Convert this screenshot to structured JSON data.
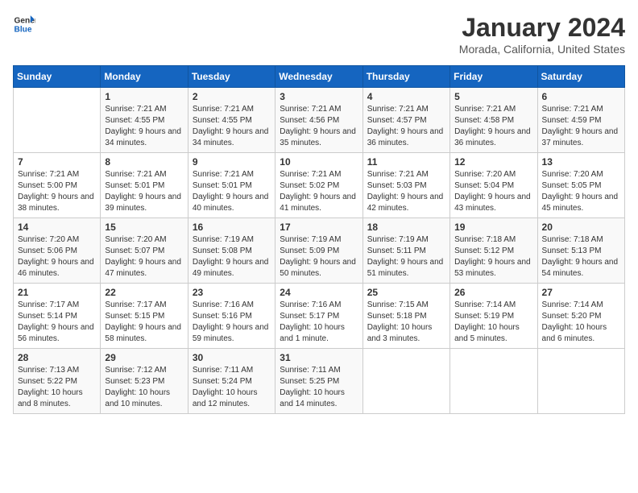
{
  "logo": {
    "line1": "General",
    "line2": "Blue"
  },
  "title": "January 2024",
  "subtitle": "Morada, California, United States",
  "weekdays": [
    "Sunday",
    "Monday",
    "Tuesday",
    "Wednesday",
    "Thursday",
    "Friday",
    "Saturday"
  ],
  "weeks": [
    [
      {
        "day": "",
        "sunrise": "",
        "sunset": "",
        "daylight": ""
      },
      {
        "day": "1",
        "sunrise": "Sunrise: 7:21 AM",
        "sunset": "Sunset: 4:55 PM",
        "daylight": "Daylight: 9 hours and 34 minutes."
      },
      {
        "day": "2",
        "sunrise": "Sunrise: 7:21 AM",
        "sunset": "Sunset: 4:55 PM",
        "daylight": "Daylight: 9 hours and 34 minutes."
      },
      {
        "day": "3",
        "sunrise": "Sunrise: 7:21 AM",
        "sunset": "Sunset: 4:56 PM",
        "daylight": "Daylight: 9 hours and 35 minutes."
      },
      {
        "day": "4",
        "sunrise": "Sunrise: 7:21 AM",
        "sunset": "Sunset: 4:57 PM",
        "daylight": "Daylight: 9 hours and 36 minutes."
      },
      {
        "day": "5",
        "sunrise": "Sunrise: 7:21 AM",
        "sunset": "Sunset: 4:58 PM",
        "daylight": "Daylight: 9 hours and 36 minutes."
      },
      {
        "day": "6",
        "sunrise": "Sunrise: 7:21 AM",
        "sunset": "Sunset: 4:59 PM",
        "daylight": "Daylight: 9 hours and 37 minutes."
      }
    ],
    [
      {
        "day": "7",
        "sunrise": "Sunrise: 7:21 AM",
        "sunset": "Sunset: 5:00 PM",
        "daylight": "Daylight: 9 hours and 38 minutes."
      },
      {
        "day": "8",
        "sunrise": "Sunrise: 7:21 AM",
        "sunset": "Sunset: 5:01 PM",
        "daylight": "Daylight: 9 hours and 39 minutes."
      },
      {
        "day": "9",
        "sunrise": "Sunrise: 7:21 AM",
        "sunset": "Sunset: 5:01 PM",
        "daylight": "Daylight: 9 hours and 40 minutes."
      },
      {
        "day": "10",
        "sunrise": "Sunrise: 7:21 AM",
        "sunset": "Sunset: 5:02 PM",
        "daylight": "Daylight: 9 hours and 41 minutes."
      },
      {
        "day": "11",
        "sunrise": "Sunrise: 7:21 AM",
        "sunset": "Sunset: 5:03 PM",
        "daylight": "Daylight: 9 hours and 42 minutes."
      },
      {
        "day": "12",
        "sunrise": "Sunrise: 7:20 AM",
        "sunset": "Sunset: 5:04 PM",
        "daylight": "Daylight: 9 hours and 43 minutes."
      },
      {
        "day": "13",
        "sunrise": "Sunrise: 7:20 AM",
        "sunset": "Sunset: 5:05 PM",
        "daylight": "Daylight: 9 hours and 45 minutes."
      }
    ],
    [
      {
        "day": "14",
        "sunrise": "Sunrise: 7:20 AM",
        "sunset": "Sunset: 5:06 PM",
        "daylight": "Daylight: 9 hours and 46 minutes."
      },
      {
        "day": "15",
        "sunrise": "Sunrise: 7:20 AM",
        "sunset": "Sunset: 5:07 PM",
        "daylight": "Daylight: 9 hours and 47 minutes."
      },
      {
        "day": "16",
        "sunrise": "Sunrise: 7:19 AM",
        "sunset": "Sunset: 5:08 PM",
        "daylight": "Daylight: 9 hours and 49 minutes."
      },
      {
        "day": "17",
        "sunrise": "Sunrise: 7:19 AM",
        "sunset": "Sunset: 5:09 PM",
        "daylight": "Daylight: 9 hours and 50 minutes."
      },
      {
        "day": "18",
        "sunrise": "Sunrise: 7:19 AM",
        "sunset": "Sunset: 5:11 PM",
        "daylight": "Daylight: 9 hours and 51 minutes."
      },
      {
        "day": "19",
        "sunrise": "Sunrise: 7:18 AM",
        "sunset": "Sunset: 5:12 PM",
        "daylight": "Daylight: 9 hours and 53 minutes."
      },
      {
        "day": "20",
        "sunrise": "Sunrise: 7:18 AM",
        "sunset": "Sunset: 5:13 PM",
        "daylight": "Daylight: 9 hours and 54 minutes."
      }
    ],
    [
      {
        "day": "21",
        "sunrise": "Sunrise: 7:17 AM",
        "sunset": "Sunset: 5:14 PM",
        "daylight": "Daylight: 9 hours and 56 minutes."
      },
      {
        "day": "22",
        "sunrise": "Sunrise: 7:17 AM",
        "sunset": "Sunset: 5:15 PM",
        "daylight": "Daylight: 9 hours and 58 minutes."
      },
      {
        "day": "23",
        "sunrise": "Sunrise: 7:16 AM",
        "sunset": "Sunset: 5:16 PM",
        "daylight": "Daylight: 9 hours and 59 minutes."
      },
      {
        "day": "24",
        "sunrise": "Sunrise: 7:16 AM",
        "sunset": "Sunset: 5:17 PM",
        "daylight": "Daylight: 10 hours and 1 minute."
      },
      {
        "day": "25",
        "sunrise": "Sunrise: 7:15 AM",
        "sunset": "Sunset: 5:18 PM",
        "daylight": "Daylight: 10 hours and 3 minutes."
      },
      {
        "day": "26",
        "sunrise": "Sunrise: 7:14 AM",
        "sunset": "Sunset: 5:19 PM",
        "daylight": "Daylight: 10 hours and 5 minutes."
      },
      {
        "day": "27",
        "sunrise": "Sunrise: 7:14 AM",
        "sunset": "Sunset: 5:20 PM",
        "daylight": "Daylight: 10 hours and 6 minutes."
      }
    ],
    [
      {
        "day": "28",
        "sunrise": "Sunrise: 7:13 AM",
        "sunset": "Sunset: 5:22 PM",
        "daylight": "Daylight: 10 hours and 8 minutes."
      },
      {
        "day": "29",
        "sunrise": "Sunrise: 7:12 AM",
        "sunset": "Sunset: 5:23 PM",
        "daylight": "Daylight: 10 hours and 10 minutes."
      },
      {
        "day": "30",
        "sunrise": "Sunrise: 7:11 AM",
        "sunset": "Sunset: 5:24 PM",
        "daylight": "Daylight: 10 hours and 12 minutes."
      },
      {
        "day": "31",
        "sunrise": "Sunrise: 7:11 AM",
        "sunset": "Sunset: 5:25 PM",
        "daylight": "Daylight: 10 hours and 14 minutes."
      },
      {
        "day": "",
        "sunrise": "",
        "sunset": "",
        "daylight": ""
      },
      {
        "day": "",
        "sunrise": "",
        "sunset": "",
        "daylight": ""
      },
      {
        "day": "",
        "sunrise": "",
        "sunset": "",
        "daylight": ""
      }
    ]
  ]
}
